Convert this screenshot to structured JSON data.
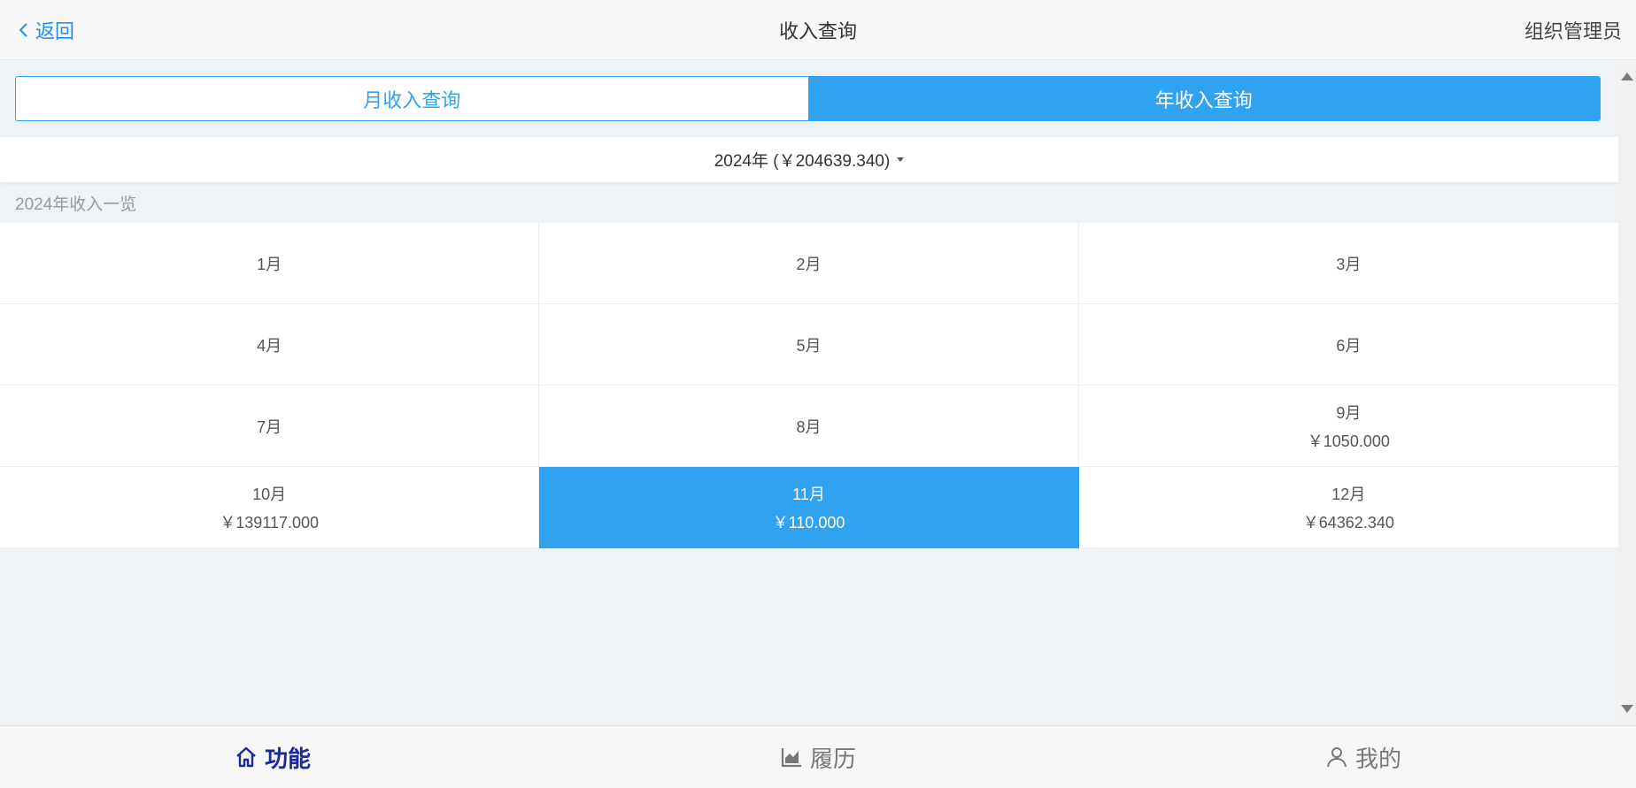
{
  "header": {
    "back_label": "返回",
    "title": "收入查询",
    "user": "组织管理员"
  },
  "segments": [
    {
      "label": "月收入查询",
      "active": false
    },
    {
      "label": "年收入查询",
      "active": true
    }
  ],
  "year_select": {
    "label": "2024年 (￥204639.340)"
  },
  "section_label": "2024年收入一览",
  "months": [
    {
      "label": "1月",
      "amount": ""
    },
    {
      "label": "2月",
      "amount": ""
    },
    {
      "label": "3月",
      "amount": ""
    },
    {
      "label": "4月",
      "amount": ""
    },
    {
      "label": "5月",
      "amount": ""
    },
    {
      "label": "6月",
      "amount": ""
    },
    {
      "label": "7月",
      "amount": ""
    },
    {
      "label": "8月",
      "amount": ""
    },
    {
      "label": "9月",
      "amount": "￥1050.000"
    },
    {
      "label": "10月",
      "amount": "￥139117.000"
    },
    {
      "label": "11月",
      "amount": "￥110.000"
    },
    {
      "label": "12月",
      "amount": "￥64362.340"
    }
  ],
  "selected_month": "11月",
  "tabbar": [
    {
      "label": "功能",
      "icon": "home-icon",
      "active": true
    },
    {
      "label": "履历",
      "icon": "chart-icon",
      "active": false
    },
    {
      "label": "我的",
      "icon": "user-icon",
      "active": false
    }
  ],
  "colors": {
    "accent": "#31a2ef",
    "active_tab": "#1a2a9a",
    "background": "#eff3f8"
  }
}
